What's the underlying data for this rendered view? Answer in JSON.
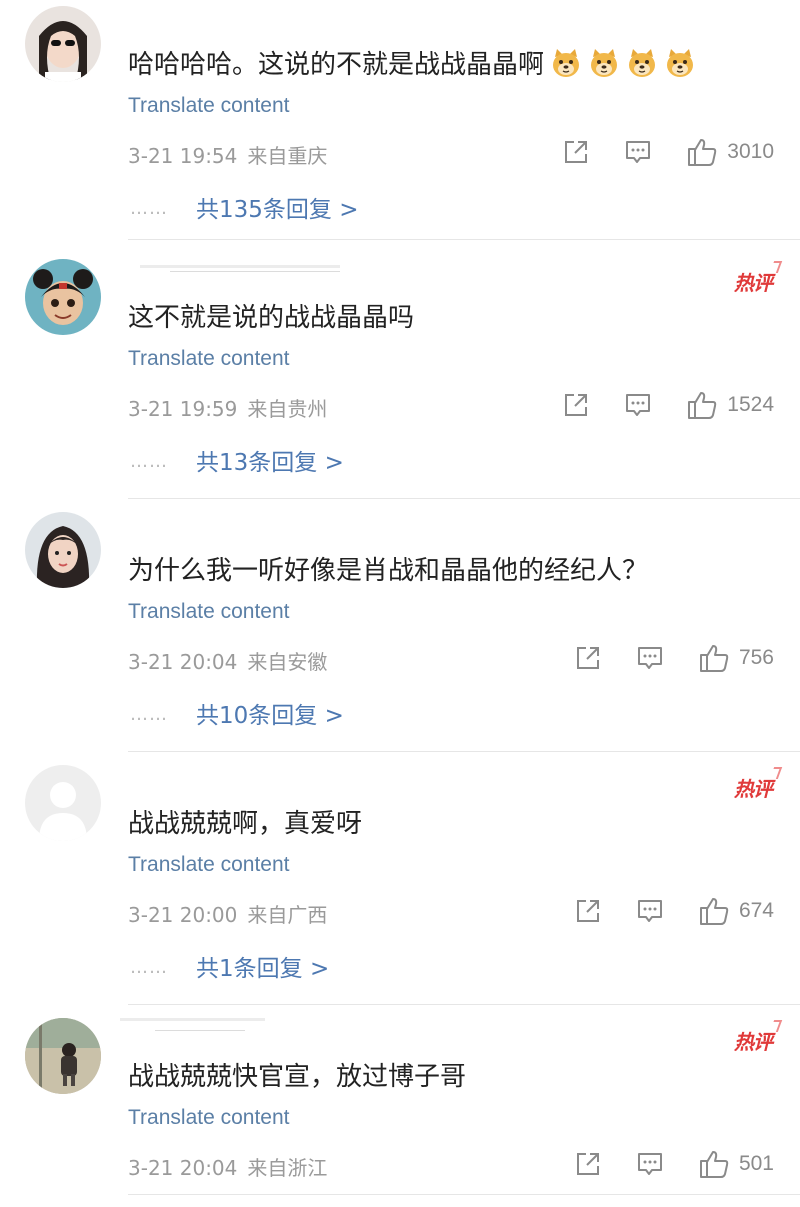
{
  "comments": [
    {
      "text": "哈哈哈哈。这说的不就是战战晶晶啊",
      "emoji_count": 4,
      "hot": false,
      "translate": "Translate content",
      "date": "3-21 19:54",
      "location": "来自重庆",
      "likes": "3010",
      "replies": "共135条回复 >"
    },
    {
      "text": "这不就是说的战战晶晶吗",
      "hot": true,
      "hot_label": "热评",
      "translate": "Translate content",
      "date": "3-21 19:59",
      "location": "来自贵州",
      "likes": "1524",
      "replies": "共13条回复 >"
    },
    {
      "text": "为什么我一听好像是肖战和晶晶他的经纪人？",
      "hot": false,
      "translate": "Translate content",
      "date": "3-21 20:04",
      "location": "来自安徽",
      "likes": "756",
      "replies": "共10条回复 >"
    },
    {
      "text": "战战兢兢啊，真爱呀",
      "hot": true,
      "hot_label": "热评",
      "translate": "Translate content",
      "date": "3-21 20:00",
      "location": "来自广西",
      "likes": "674",
      "replies": "共1条回复 >"
    },
    {
      "text": "战战兢兢快官宣，放过博子哥",
      "hot": true,
      "hot_label": "热评",
      "translate": "Translate content",
      "date": "3-21 20:04",
      "location": "来自浙江",
      "likes": "501"
    }
  ],
  "reply_dots": "……",
  "icons": {
    "share": "share-icon",
    "comment": "comment-icon",
    "like": "thumbs-up-icon",
    "emoji": "doge-emoji-icon"
  },
  "colors": {
    "link": "#5b7fa6",
    "reply": "#4d78b1",
    "meta": "#9a9a9a",
    "hot": "#e03a3a"
  }
}
